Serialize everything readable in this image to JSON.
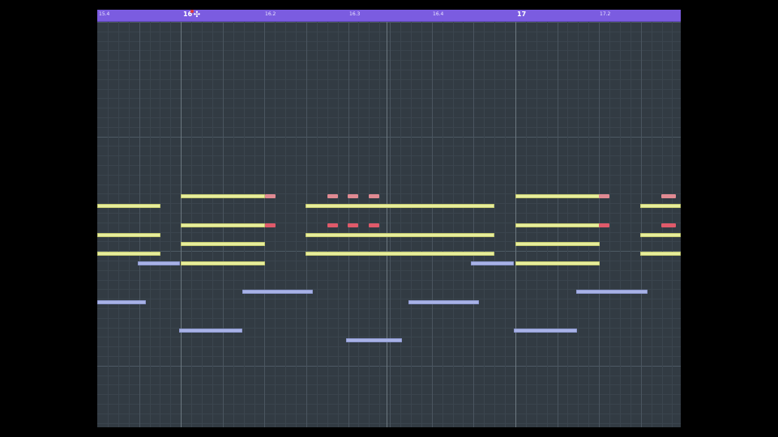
{
  "ruler": {
    "labels": [
      "15.4",
      "16",
      "16.2",
      "16.3",
      "16.4",
      "17",
      "17.2"
    ],
    "color": "#7b5ce0",
    "playhead_icon": "playhead-cursor-icon"
  },
  "grid": {
    "background": "#323b43",
    "note_colors": {
      "chord": "#e8ee9c",
      "bass": "#a8b2e6",
      "accent": "#e05a6a"
    }
  }
}
